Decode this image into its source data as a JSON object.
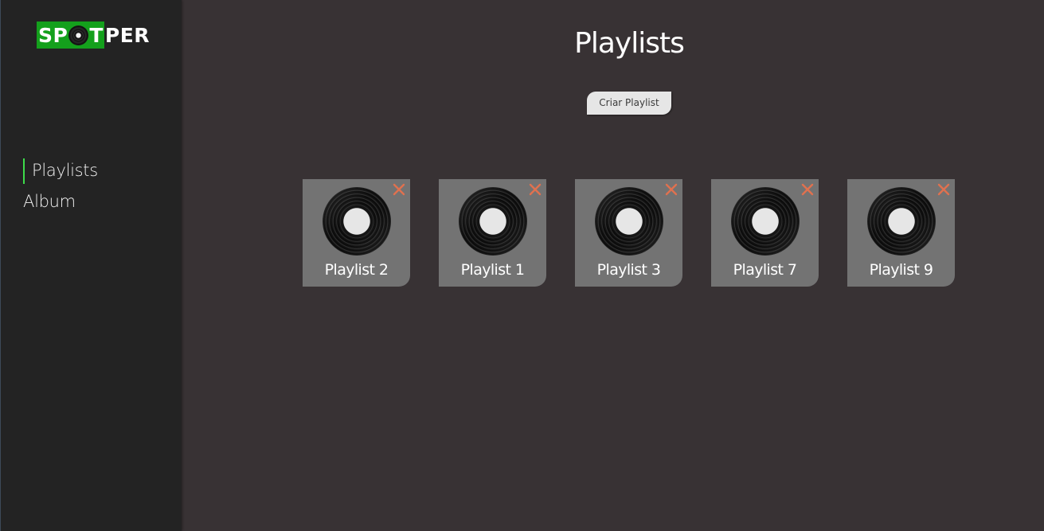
{
  "app": {
    "logo": {
      "part1": "SP",
      "part2": "T",
      "part3": "PER",
      "accent": "#14a01c"
    }
  },
  "sidebar": {
    "items": [
      {
        "label": "Playlists",
        "active": true
      },
      {
        "label": "Album",
        "active": false
      }
    ],
    "active_indicator_color": "#3ddc4a"
  },
  "main": {
    "title": "Playlists",
    "create_button_label": "Criar Playlist",
    "playlists": [
      {
        "name": "Playlist 2",
        "icon": "vinyl-record-icon"
      },
      {
        "name": "Playlist 1",
        "icon": "vinyl-record-icon"
      },
      {
        "name": "Playlist 3",
        "icon": "vinyl-record-icon"
      },
      {
        "name": "Playlist 7",
        "icon": "vinyl-record-icon"
      },
      {
        "name": "Playlist 9",
        "icon": "vinyl-record-icon"
      }
    ],
    "delete_icon": "close-icon",
    "delete_icon_color": "#e0714f"
  }
}
